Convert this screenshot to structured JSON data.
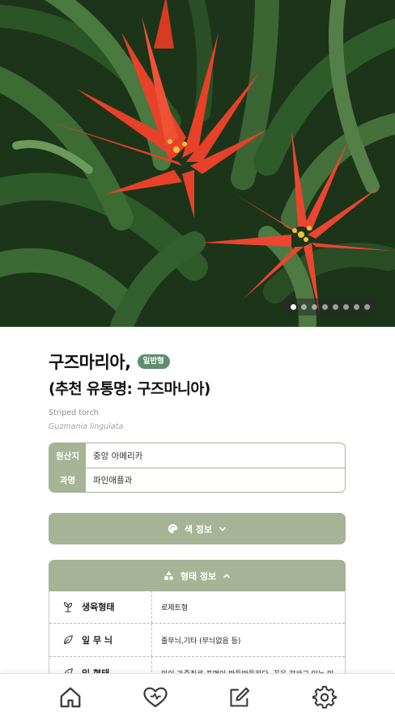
{
  "carousel": {
    "total": 8,
    "active": 0
  },
  "plant": {
    "name": "구즈마리아,",
    "badge": "일반형",
    "alias": "(추천 유통명: 구즈마니아)",
    "english_name": "Striped torch",
    "scientific_name": "Guzmania lingulata"
  },
  "info": [
    {
      "key": "원산지",
      "value": "중앙 아메리카"
    },
    {
      "key": "과명",
      "value": "파인애플과"
    }
  ],
  "color_section": {
    "label": "색 정보",
    "expanded": false,
    "icon": "palette-icon"
  },
  "form_section": {
    "label": "형태 정보",
    "expanded": true,
    "icon": "shapes-icon"
  },
  "form_rows": [
    {
      "key": "생육형태",
      "value": "로제트형",
      "icon": "plant-icon"
    },
    {
      "key": "잎 무 늬",
      "value": "줄무늬,기타 (무늬없음 등)",
      "icon": "leaf-icon"
    },
    {
      "key": "잎 형태",
      "value": "잎이 가죽질로 표면이 반들반들하다. 꽃을 감싸고 있는 잎",
      "icon": "leaf-icon"
    }
  ],
  "nav": [
    {
      "name": "home",
      "icon": "home-icon"
    },
    {
      "name": "favorites",
      "icon": "heart-icon"
    },
    {
      "name": "edit",
      "icon": "edit-icon"
    },
    {
      "name": "settings",
      "icon": "gear-icon"
    }
  ],
  "colors": {
    "accent": "#a6b396",
    "badge": "#5e8e6d",
    "flower": "#e8412a"
  }
}
